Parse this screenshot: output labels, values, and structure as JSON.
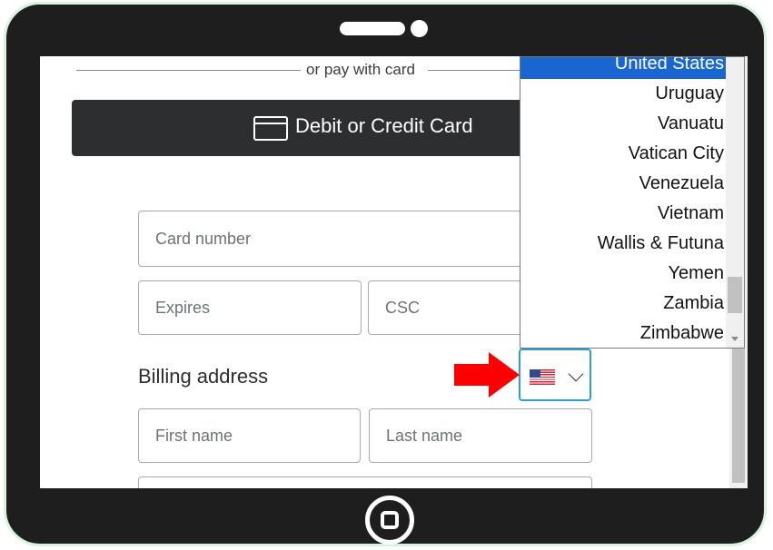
{
  "divider": {
    "text": "or pay with card"
  },
  "card_button": {
    "label": "Debit or Credit Card",
    "icon": "credit-card-icon"
  },
  "form": {
    "card_number_placeholder": "Card number",
    "expires_placeholder": "Expires",
    "csc_placeholder": "CSC",
    "billing_label": "Billing address",
    "first_name_placeholder": "First name",
    "last_name_placeholder": "Last name"
  },
  "country_select": {
    "flag": "us-flag-icon",
    "selected": "United States"
  },
  "country_list": {
    "options": [
      "United States",
      "Uruguay",
      "Vanuatu",
      "Vatican City",
      "Venezuela",
      "Vietnam",
      "Wallis & Futuna",
      "Yemen",
      "Zambia",
      "Zimbabwe"
    ],
    "selected_index": 0,
    "scroll_fraction": 1.0
  },
  "colors": {
    "selected_option": "#1a66d1",
    "select_focus_border": "#2a9fd6",
    "annotation_arrow": "#ff0000",
    "tablet_frame": "#1e1e1e"
  }
}
